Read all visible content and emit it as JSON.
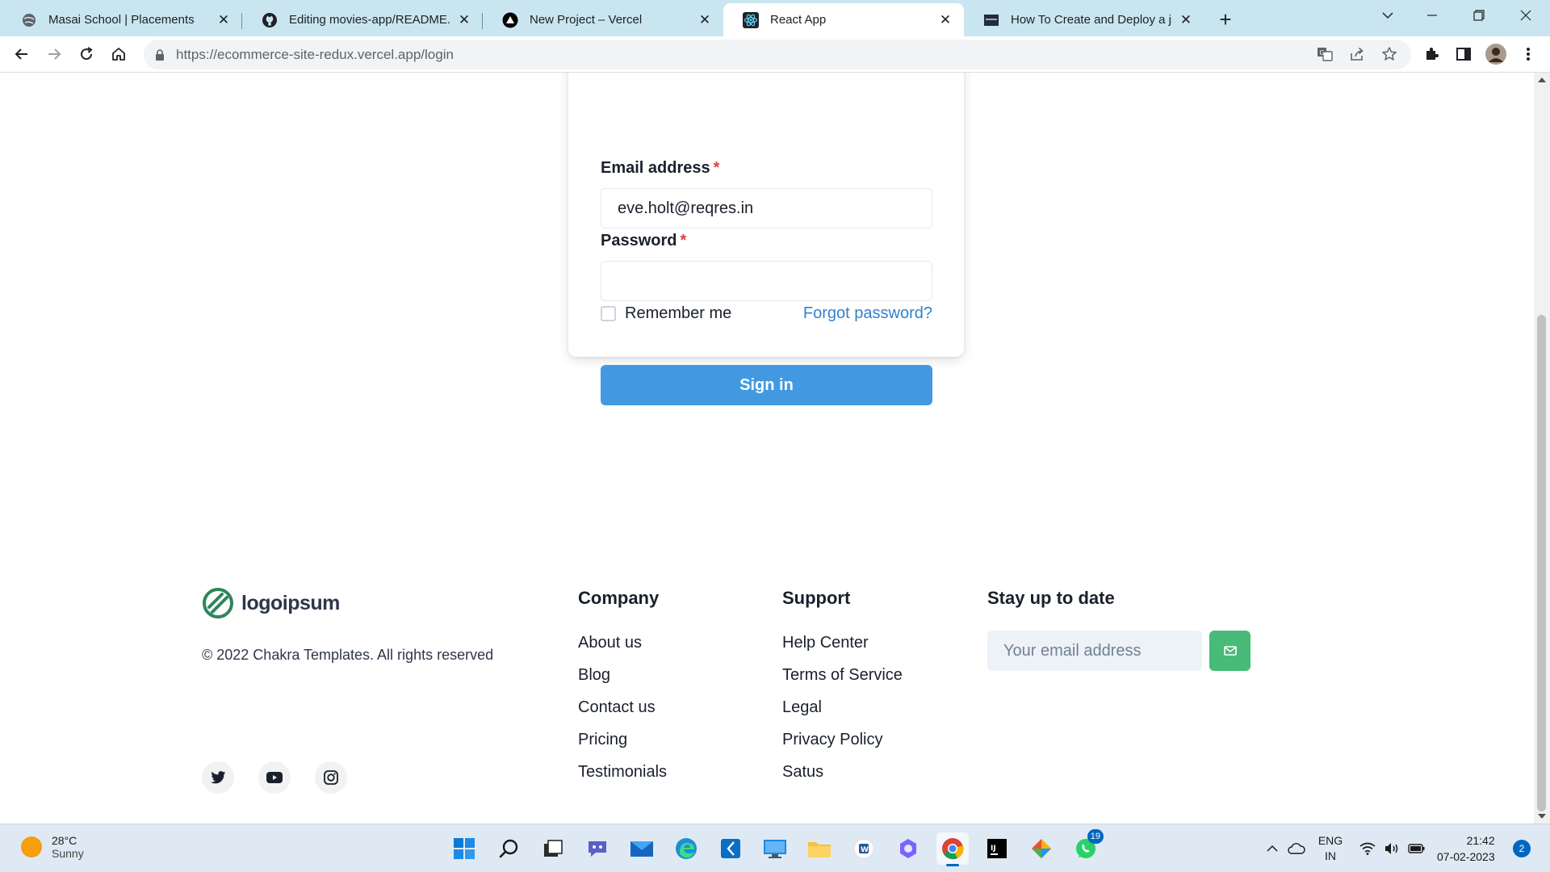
{
  "browser": {
    "tabs": [
      {
        "title": "Masai School | Placements",
        "icon": "globe-icon"
      },
      {
        "title": "Editing movies-app/README.md",
        "icon": "github-icon"
      },
      {
        "title": "New Project – Vercel",
        "icon": "vercel-icon"
      },
      {
        "title": "React App",
        "icon": "react-icon"
      },
      {
        "title": "How To Create and Deploy a json",
        "icon": "site-icon"
      }
    ],
    "active_tab": 3,
    "url_domain": "https://ecommerce-site-redux.vercel.app",
    "url_path": "/login"
  },
  "login": {
    "email_label": "Email address",
    "required_mark": "*",
    "email_value": "eve.holt@reqres.in",
    "password_label": "Password",
    "password_value": "",
    "remember_label": "Remember me",
    "forgot_label": "Forgot password?",
    "signin_label": "Sign in"
  },
  "footer": {
    "logo_text": "logoipsum",
    "copyright": "© 2022 Chakra Templates. All rights reserved",
    "social": [
      "twitter-icon",
      "youtube-icon",
      "instagram-icon"
    ],
    "company": {
      "heading": "Company",
      "links": [
        "About us",
        "Blog",
        "Contact us",
        "Pricing",
        "Testimonials"
      ]
    },
    "support": {
      "heading": "Support",
      "links": [
        "Help Center",
        "Terms of Service",
        "Legal",
        "Privacy Policy",
        "Satus"
      ]
    },
    "newsletter": {
      "heading": "Stay up to date",
      "placeholder": "Your email address"
    }
  },
  "taskbar": {
    "temperature": "28°C",
    "condition": "Sunny",
    "whatsapp_badge": "19",
    "language": "ENG",
    "region": "IN",
    "time": "21:42",
    "date": "07-02-2023",
    "notifications": "2"
  },
  "colors": {
    "primary": "#4299e1",
    "link": "#3182ce",
    "required": "#e53e3e",
    "subscribe": "#48bb78",
    "tabstrip": "#c9e6f0"
  }
}
